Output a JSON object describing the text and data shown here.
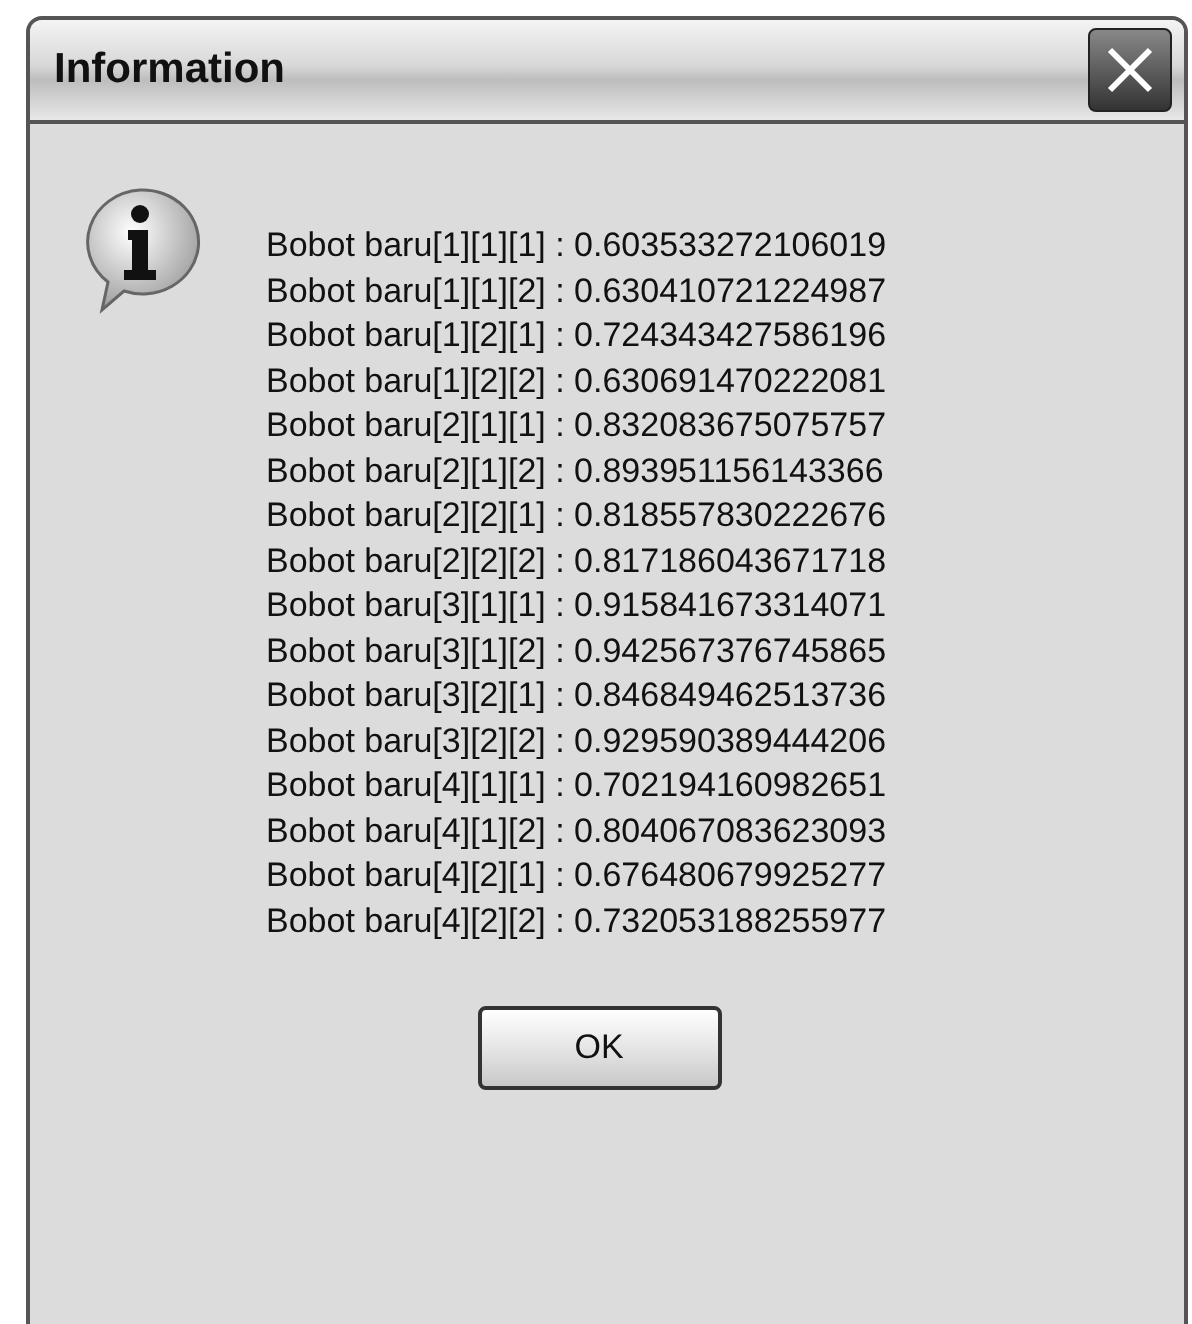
{
  "window": {
    "title": "Information"
  },
  "lines": [
    "Bobot baru[1][1][1] : 0.603533272106019",
    "Bobot baru[1][1][2] : 0.630410721224987",
    "Bobot baru[1][2][1] : 0.724343427586196",
    "Bobot baru[1][2][2] : 0.630691470222081",
    "Bobot baru[2][1][1] : 0.832083675075757",
    "Bobot baru[2][1][2] : 0.893951156143366",
    "Bobot baru[2][2][1] : 0.818557830222676",
    "Bobot baru[2][2][2] : 0.817186043671718",
    "Bobot baru[3][1][1] : 0.915841673314071",
    "Bobot baru[3][1][2] : 0.942567376745865",
    "Bobot baru[3][2][1] : 0.846849462513736",
    "Bobot baru[3][2][2] : 0.929590389444206",
    "Bobot baru[4][1][1] : 0.702194160982651",
    "Bobot baru[4][1][2] : 0.804067083623093",
    "Bobot baru[4][2][1] : 0.676480679925277",
    "Bobot baru[4][2][2] : 0.732053188255977"
  ],
  "buttons": [
    "OK"
  ]
}
